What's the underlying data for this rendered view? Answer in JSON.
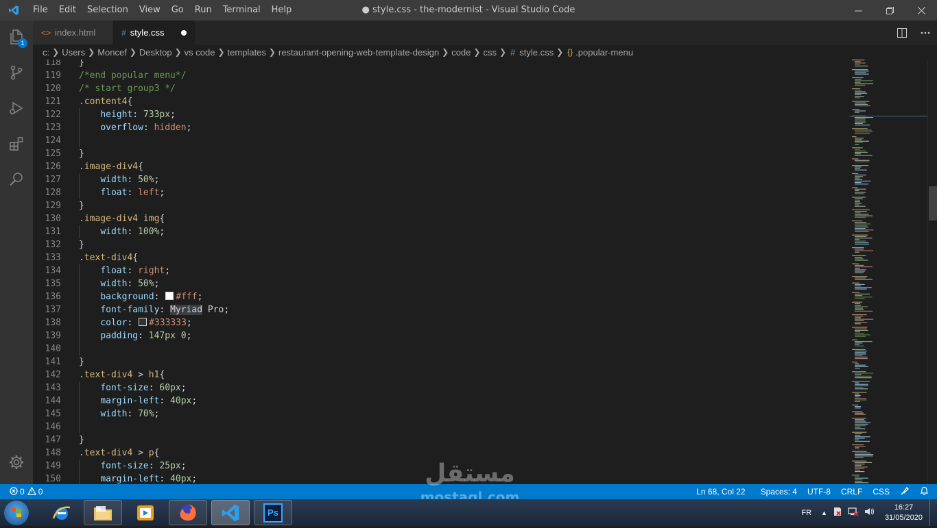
{
  "window": {
    "title": "● style.css - the-modernist - Visual Studio Code",
    "menu": [
      "File",
      "Edit",
      "Selection",
      "View",
      "Go",
      "Run",
      "Terminal",
      "Help"
    ]
  },
  "activity_bar": {
    "items": [
      "files-icon",
      "source-control-icon",
      "run-debug-icon",
      "extensions-icon",
      "search-icon"
    ],
    "explorer_badge": "1"
  },
  "tabs": [
    {
      "label": "index.html",
      "icon": "<>",
      "active": false
    },
    {
      "label": "style.css",
      "icon": "#",
      "active": true,
      "modified": true
    }
  ],
  "breadcrumb": [
    "c:",
    "Users",
    "Moncef",
    "Desktop",
    "vs code",
    "templates",
    "restaurant-opening-web-template-design",
    "code",
    "css",
    "style.css",
    ".popular-menu"
  ],
  "editor": {
    "lines": [
      {
        "n": "118",
        "code": "}"
      },
      {
        "n": "119",
        "code": "/*end popular menu*/"
      },
      {
        "n": "120",
        "code": "/* start group3 */"
      },
      {
        "n": "121",
        "code": ".content4{"
      },
      {
        "n": "122",
        "code": "    height: 733px;"
      },
      {
        "n": "123",
        "code": "    overflow: hidden;"
      },
      {
        "n": "124",
        "code": ""
      },
      {
        "n": "125",
        "code": "}"
      },
      {
        "n": "126",
        "code": ".image-div4{"
      },
      {
        "n": "127",
        "code": "    width: 50%;"
      },
      {
        "n": "128",
        "code": "    float: left;"
      },
      {
        "n": "129",
        "code": "}"
      },
      {
        "n": "130",
        "code": ".image-div4 img{"
      },
      {
        "n": "131",
        "code": "    width: 100%;"
      },
      {
        "n": "132",
        "code": "}"
      },
      {
        "n": "133",
        "code": ".text-div4{"
      },
      {
        "n": "134",
        "code": "    float: right;"
      },
      {
        "n": "135",
        "code": "    width: 50%;"
      },
      {
        "n": "136",
        "code": "    background: #fff;"
      },
      {
        "n": "137",
        "code": "    font-family: Myriad Pro;"
      },
      {
        "n": "138",
        "code": "    color: #333333;"
      },
      {
        "n": "139",
        "code": "    padding: 147px 0;"
      },
      {
        "n": "140",
        "code": ""
      },
      {
        "n": "141",
        "code": "}"
      },
      {
        "n": "142",
        "code": ".text-div4 > h1{"
      },
      {
        "n": "143",
        "code": "    font-size: 60px;"
      },
      {
        "n": "144",
        "code": "    margin-left: 40px;"
      },
      {
        "n": "145",
        "code": "    width: 70%;"
      },
      {
        "n": "146",
        "code": ""
      },
      {
        "n": "147",
        "code": "}"
      },
      {
        "n": "148",
        "code": ".text-div4 > p{"
      },
      {
        "n": "149",
        "code": "    font-size: 25px;"
      },
      {
        "n": "150",
        "code": "    margin-left: 40px;"
      }
    ],
    "colors": {
      "selector": "#d7ba7d",
      "property": "#9cdcfe",
      "value": "#ce9178",
      "number": "#b5cea8",
      "comment": "#6a9955"
    }
  },
  "status_bar": {
    "errors": "0",
    "warnings": "0",
    "position": "Ln 68, Col 22",
    "spaces": "Spaces: 4",
    "encoding": "UTF-8",
    "eol": "CRLF",
    "language": "CSS",
    "accent": "#007acc"
  },
  "watermark": {
    "arabic": "مستقل",
    "latin": "mostaql.com"
  },
  "taskbar": {
    "apps": [
      "windows-start",
      "internet-explorer-icon",
      "file-explorer-icon",
      "media-player-icon",
      "firefox-icon",
      "vscode-icon",
      "photoshop-icon"
    ],
    "photoshop_label": "Ps",
    "language": "FR",
    "time": "16:27",
    "date": "31/05/2020"
  }
}
